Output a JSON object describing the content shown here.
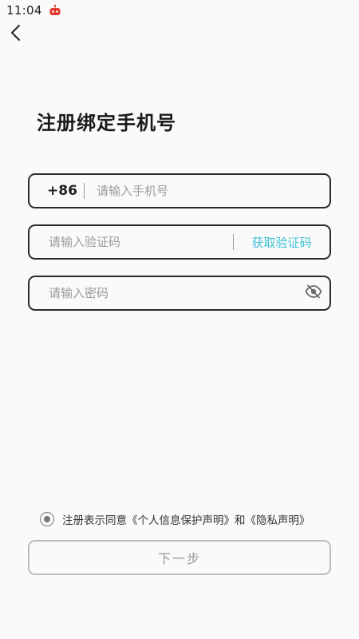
{
  "status_bar": {
    "time": "11:04",
    "app_icon": "robot-notification-icon"
  },
  "header": {
    "back_icon": "chevron-left-icon"
  },
  "title": "注册绑定手机号",
  "phone_field": {
    "country_code": "+86",
    "placeholder": "请输入手机号",
    "value": ""
  },
  "code_field": {
    "placeholder": "请输入验证码",
    "value": "",
    "get_code_label": "获取验证码"
  },
  "password_field": {
    "placeholder": "请输入密码",
    "value": "",
    "visibility_icon": "eye-off-icon"
  },
  "agreement": {
    "text": "注册表示同意《个人信息保护声明》和《隐私声明》",
    "checked": true
  },
  "next_button": {
    "label": "下一步"
  },
  "colors": {
    "accent": "#3ec1d6",
    "border": "#2b2b2b",
    "disabled": "#bdbdbd",
    "background": "#fafafa",
    "status_icon": "#e0392b"
  }
}
